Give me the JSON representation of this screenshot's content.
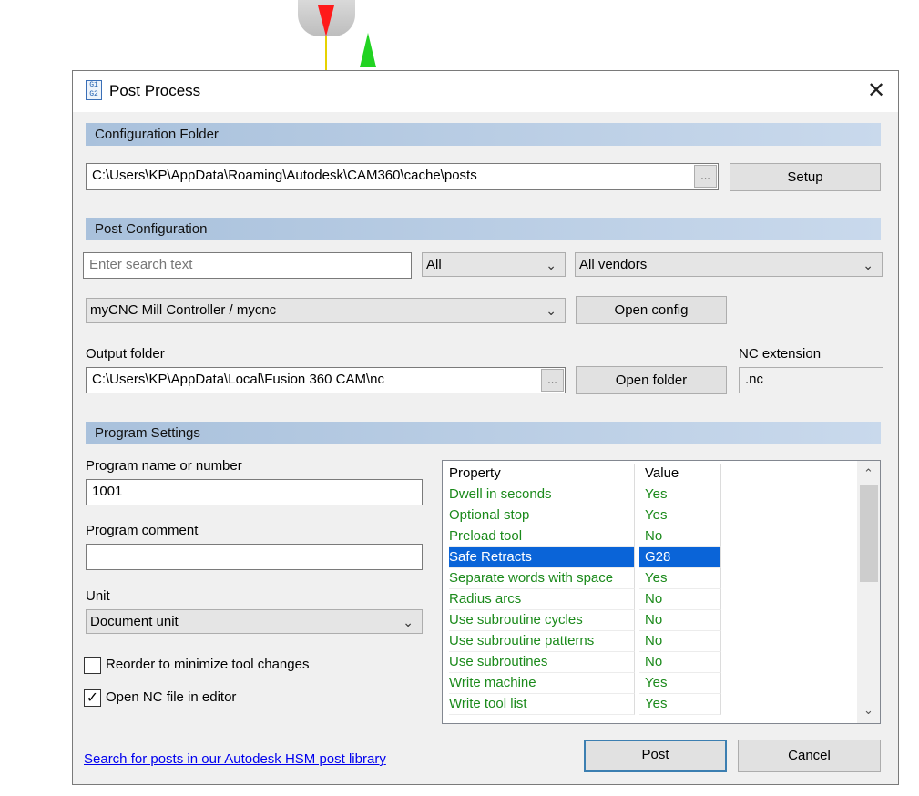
{
  "dialog": {
    "title": "Post Process",
    "icon_text": "G1\nG2",
    "close_glyph": "✕"
  },
  "config_folder": {
    "header": "Configuration Folder",
    "path": "C:\\Users\\KP\\AppData\\Roaming\\Autodesk\\CAM360\\cache\\posts",
    "browse_label": "...",
    "setup_label": "Setup"
  },
  "post_config": {
    "header": "Post Configuration",
    "search_placeholder": "Enter search text",
    "filter_selected": "All",
    "vendor_selected": "All vendors",
    "post_selected": "myCNC Mill Controller / mycnc",
    "open_config_label": "Open config",
    "output_folder_label": "Output folder",
    "output_folder_path": "C:\\Users\\KP\\AppData\\Local\\Fusion 360 CAM\\nc",
    "output_browse_label": "...",
    "open_folder_label": "Open folder",
    "nc_extension_label": "NC extension",
    "nc_extension_value": ".nc"
  },
  "program_settings": {
    "header": "Program Settings",
    "name_label": "Program name or number",
    "name_value": "1001",
    "comment_label": "Program comment",
    "comment_value": "",
    "unit_label": "Unit",
    "unit_selected": "Document unit",
    "reorder_label": "Reorder to minimize tool changes",
    "reorder_checked": false,
    "open_nc_label": "Open NC file in editor",
    "open_nc_checked": true,
    "check_glyph": "✓"
  },
  "properties": {
    "col_property": "Property",
    "col_value": "Value",
    "rows": [
      {
        "property": "Dwell in seconds",
        "value": "Yes"
      },
      {
        "property": "Optional stop",
        "value": "Yes"
      },
      {
        "property": "Preload tool",
        "value": "No"
      },
      {
        "property": "Safe Retracts",
        "value": "G28"
      },
      {
        "property": "Separate words with space",
        "value": "Yes"
      },
      {
        "property": "Radius arcs",
        "value": "No"
      },
      {
        "property": "Use subroutine cycles",
        "value": "No"
      },
      {
        "property": "Use subroutine patterns",
        "value": "No"
      },
      {
        "property": "Use subroutines",
        "value": "No"
      },
      {
        "property": "Write machine",
        "value": "Yes"
      },
      {
        "property": "Write tool list",
        "value": "Yes"
      }
    ],
    "selected_index": 3
  },
  "footer": {
    "library_link": "Search for posts in our Autodesk HSM post library",
    "post_label": "Post",
    "cancel_label": "Cancel"
  },
  "colors": {
    "section_header": "#a9c1dc",
    "property_text": "#1b8a1b",
    "selection": "#0a64d8",
    "link": "#0000ee"
  }
}
